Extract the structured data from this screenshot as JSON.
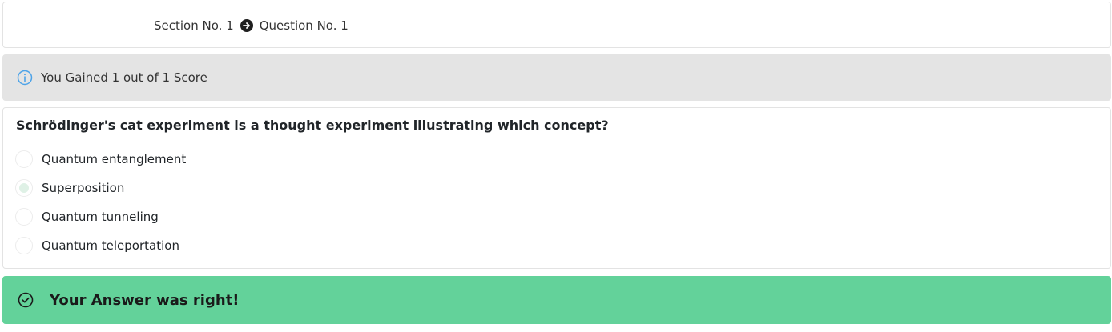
{
  "breadcrumb": {
    "section": "Section No. 1",
    "question": "Question No. 1",
    "separator_icon": "arrow-circle-right-icon"
  },
  "score_info": {
    "icon": "info-circle-icon",
    "text": "You Gained 1 out of 1 Score"
  },
  "question": {
    "text": "Schrödinger's cat experiment is a thought experiment illustrating which concept?",
    "options": [
      {
        "label": "Quantum entanglement",
        "selected": false
      },
      {
        "label": "Superposition",
        "selected": true
      },
      {
        "label": "Quantum tunneling",
        "selected": false
      },
      {
        "label": "Quantum teleportation",
        "selected": false
      }
    ]
  },
  "result": {
    "icon": "check-circle-icon",
    "text": "Your Answer was right!",
    "color": "#63d29a"
  }
}
